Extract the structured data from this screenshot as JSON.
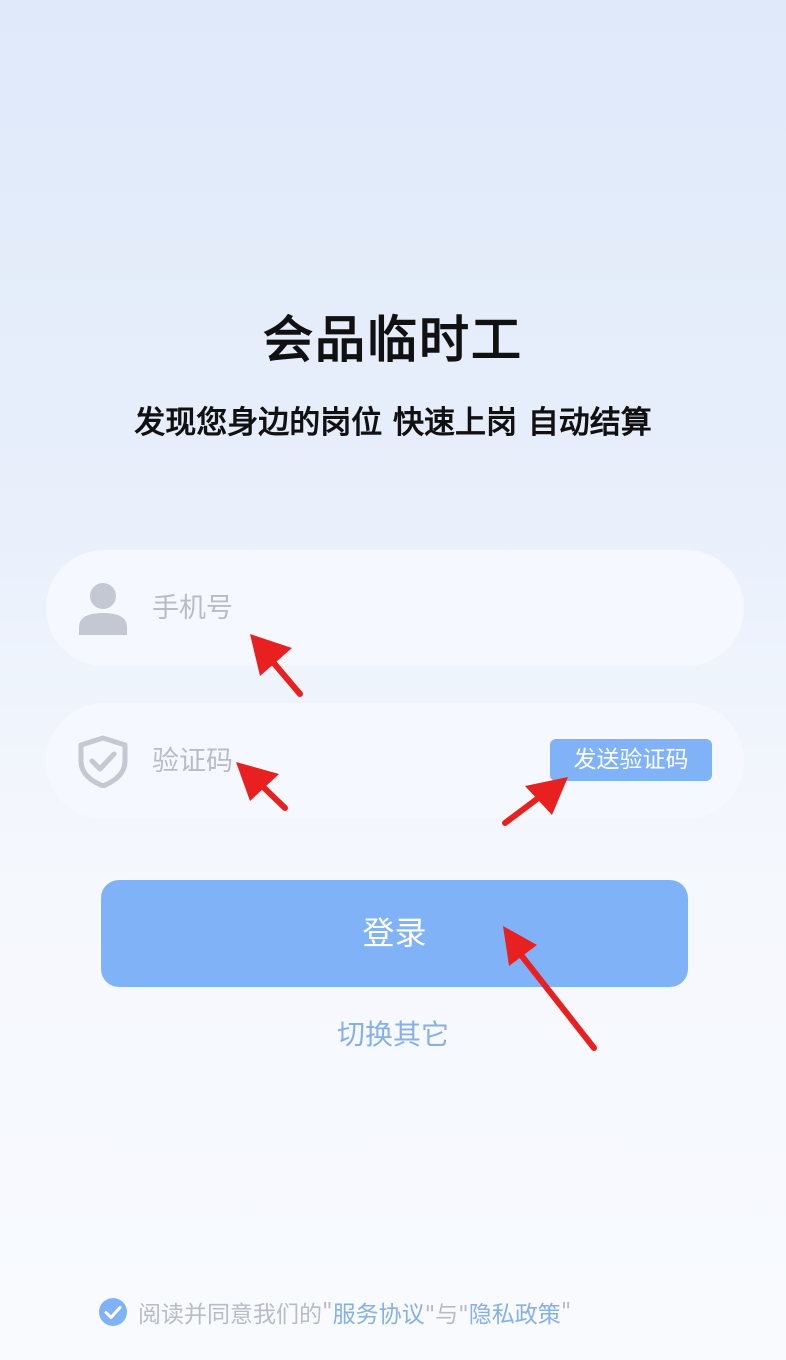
{
  "app": {
    "title": "会品临时工",
    "slogan": "发现您身边的岗位 快速上岗 自动结算"
  },
  "form": {
    "phone": {
      "placeholder": "手机号",
      "value": "",
      "icon": "user-icon"
    },
    "code": {
      "placeholder": "验证码",
      "value": "",
      "icon": "shield-check-icon"
    },
    "send_code_label": "发送验证码"
  },
  "login_label": "登录",
  "switch_label": "切换其它",
  "agreement": {
    "checked": true,
    "prefix": "阅读并同意我们的",
    "q1": "\"",
    "service_link": "服务协议",
    "mid": "\"与\"",
    "privacy_link": "隐私政策",
    "q2": "\""
  },
  "colors": {
    "accent": "#80b2f8",
    "link": "#86b0e8",
    "placeholder": "#b7bcc6",
    "annotation_arrow": "#e8201f"
  }
}
